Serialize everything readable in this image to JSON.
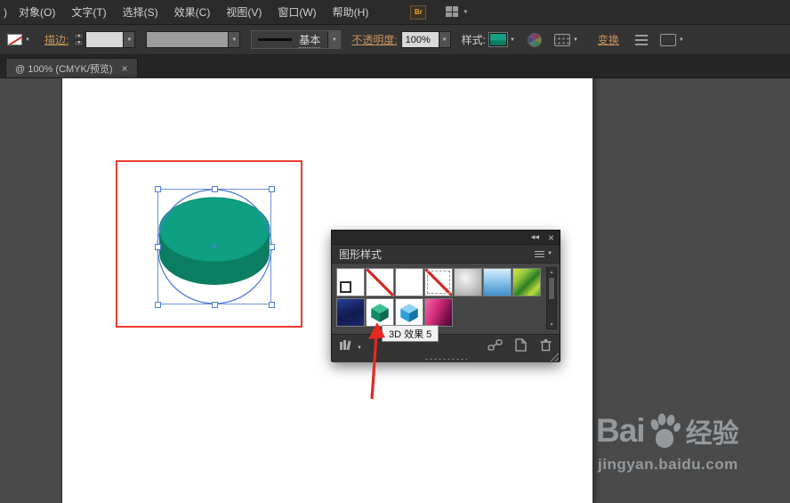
{
  "colors": {
    "accent_red": "#ee3b30",
    "selection_blue": "#4f7fd9",
    "cylinder_top": "#0fa083",
    "cylinder_side": "#0b7d62"
  },
  "menubar": {
    "truncated_item": ")",
    "items": [
      "对象(O)",
      "文字(T)",
      "选择(S)",
      "效果(C)",
      "视图(V)",
      "窗口(W)",
      "帮助(H)"
    ]
  },
  "controlbar": {
    "stroke_label": "描边:",
    "brush_name": "基本",
    "opacity_label": "不透明度:",
    "opacity_value": "100%",
    "style_label": "样式:",
    "transform_label": "变换"
  },
  "document_tab": {
    "title": "@ 100% (CMYK/预览)",
    "close": "×"
  },
  "panel": {
    "title": "图形样式",
    "tooltip": "3D 效果 5",
    "collapse_icon": "◀◀",
    "close_icon": "×"
  },
  "watermark": {
    "brand_left": "Bai",
    "brand_right": "经验",
    "url": "jingyan.baidu.com"
  },
  "icons": {
    "dropdown": "▼",
    "up": "▲",
    "down": "▼",
    "bridge": "Br"
  }
}
